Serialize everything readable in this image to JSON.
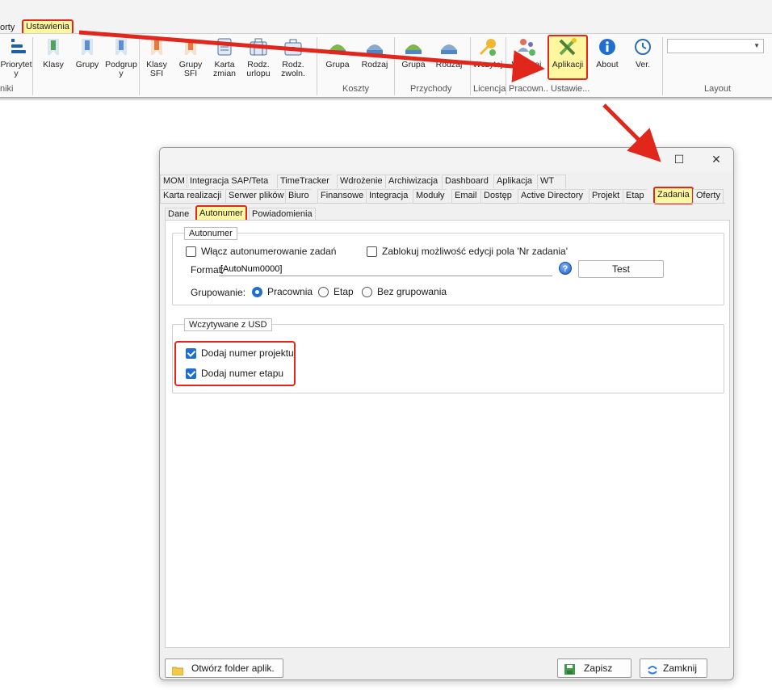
{
  "ribbon": {
    "tab_prev": "orty",
    "tab_selected": "Ustawienia",
    "buttons": [
      {
        "label": "Priorytet\ny",
        "icon": "priority-icon"
      },
      {
        "label": "Klasy",
        "icon": "bookmark-green-icon"
      },
      {
        "label": "Grupy",
        "icon": "bookmark-blue-icon"
      },
      {
        "label": "Podgrup\ny",
        "icon": "bookmark-blue-icon"
      },
      {
        "label": "Klasy\nSFI",
        "icon": "bookmark-orange-icon"
      },
      {
        "label": "Grupy\nSFI",
        "icon": "bookmark-orange-icon"
      },
      {
        "label": "Karta\nzmian",
        "icon": "card-icon"
      },
      {
        "label": "Rodz.\nurlopu",
        "icon": "suitcase-icon"
      },
      {
        "label": "Rodz.\nzwoln.",
        "icon": "briefcase-icon"
      },
      {
        "label": "Grupa",
        "icon": "cost-group-icon"
      },
      {
        "label": "Rodzaj",
        "icon": "cost-type-icon"
      },
      {
        "label": "Grupa",
        "icon": "income-group-icon"
      },
      {
        "label": "Rodzaj",
        "icon": "income-type-icon"
      },
      {
        "label": "Wczytaj",
        "icon": "key-icon"
      },
      {
        "label": "Wczytaj",
        "icon": "users-add-icon"
      },
      {
        "label": "Aplikacji",
        "icon": "tools-icon"
      },
      {
        "label": "About",
        "icon": "info-icon"
      },
      {
        "label": "Ver.",
        "icon": "history-icon"
      }
    ],
    "groups": {
      "niki": "niki",
      "koszty": "Koszty",
      "przychody": "Przychody",
      "licencja": "Licencja",
      "pracown": "Pracown..",
      "ustawie": "Ustawie...",
      "layout": "Layout"
    },
    "layout_value": ""
  },
  "dialog": {
    "tabs_row1": [
      "MOM",
      "Integracja SAP/Teta",
      "TimeTracker",
      "Wdrożenie",
      "Archiwizacja",
      "Dashboard",
      "Aplikacja",
      "WT"
    ],
    "tabs_row2": [
      "Karta realizacji",
      "Serwer plików",
      "Biuro",
      "Finansowe",
      "Integracja",
      "Moduły",
      "Email",
      "Dostęp",
      "Active Directory",
      "Projekt",
      "Etap",
      "Zadania",
      "Oferty"
    ],
    "subtabs": [
      "Dane",
      "Autonumer",
      "Powiadomienia"
    ],
    "autonumer": {
      "legend": "Autonumer",
      "enable_label": "Włącz autonumerowanie zadań",
      "enable_checked": false,
      "lock_label": "Zablokuj możliwość edycji pola 'Nr zadania'",
      "lock_checked": false,
      "format_label": "Format:",
      "format_value": "[AutoNum0000]",
      "help_glyph": "?",
      "test_label": "Test",
      "grouping_label": "Grupowanie:",
      "grouping_options": [
        "Pracownia",
        "Etap",
        "Bez grupowania"
      ],
      "grouping_selected": "Pracownia"
    },
    "usd": {
      "legend": "Wczytywane z USD",
      "project_label": "Dodaj numer projektu",
      "project_checked": true,
      "stage_label": "Dodaj numer etapu",
      "stage_checked": true
    },
    "footer": {
      "open_folder": "Otwórz folder aplik.",
      "save": "Zapisz",
      "close": "Zamknij"
    },
    "window_buttons": {
      "maximize": "☐",
      "close": "✕"
    }
  },
  "colors": {
    "highlight_fill": "#fff7a0",
    "highlight_border": "#e1261c",
    "checkbox_blue": "#1f6fd1",
    "arrow_red": "#e1261c"
  }
}
